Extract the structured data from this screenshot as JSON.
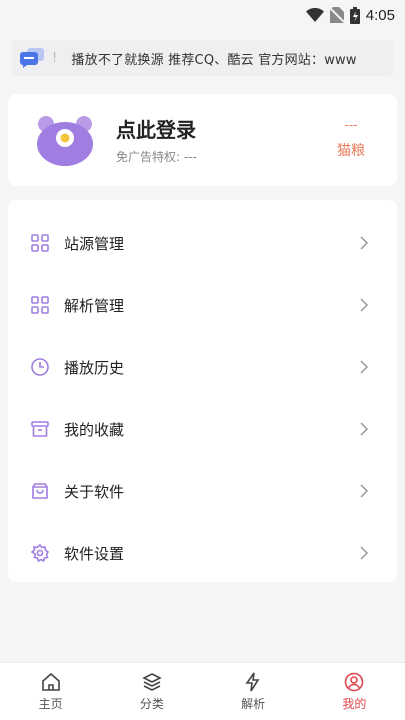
{
  "status_bar": {
    "time": "4:05"
  },
  "notice": {
    "lead": "!",
    "text": "播放不了就换源 推荐CQ、酷云 官方网站：www"
  },
  "user": {
    "login_title": "点此登录",
    "privilege": "免广告特权: ---",
    "coin_count": "---",
    "coin_label": "猫粮"
  },
  "menu": {
    "items": [
      {
        "label": "站源管理",
        "icon": "grid-icon"
      },
      {
        "label": "解析管理",
        "icon": "grid-icon"
      },
      {
        "label": "播放历史",
        "icon": "clock-icon"
      },
      {
        "label": "我的收藏",
        "icon": "archive-icon"
      },
      {
        "label": "关于软件",
        "icon": "bag-icon"
      },
      {
        "label": "软件设置",
        "icon": "gear-icon"
      }
    ]
  },
  "tabs": [
    {
      "label": "主页",
      "icon": "home-icon"
    },
    {
      "label": "分类",
      "icon": "layers-icon"
    },
    {
      "label": "解析",
      "icon": "lightning-icon"
    },
    {
      "label": "我的",
      "icon": "user-icon",
      "active": true
    }
  ],
  "colors": {
    "accent": "#a07de0",
    "active_tab": "#e2474d",
    "coin": "#e87b5a"
  }
}
